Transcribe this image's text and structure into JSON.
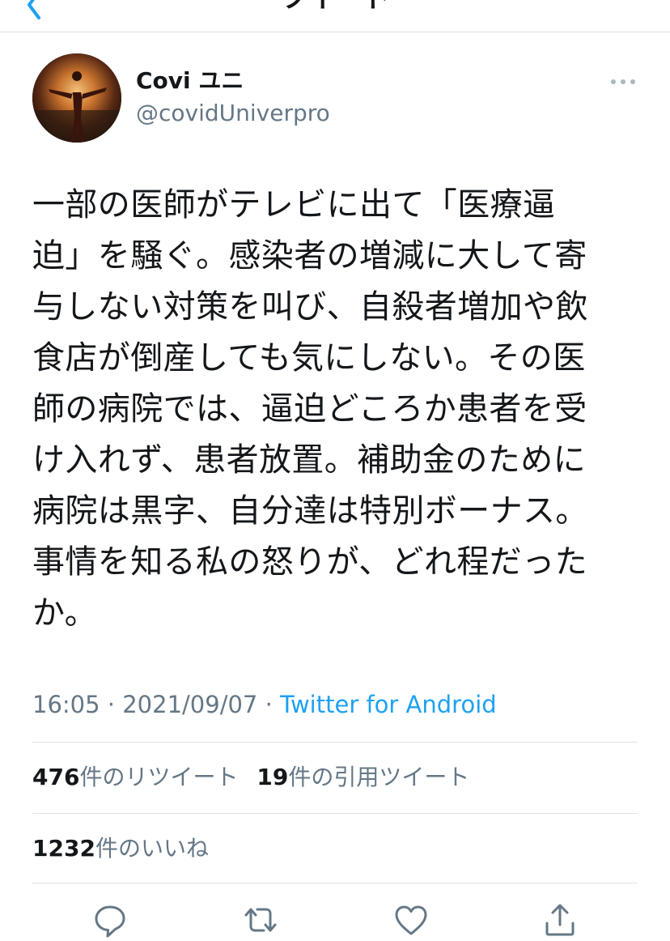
{
  "nav": {
    "title": "ツイート"
  },
  "tweet": {
    "author_name": "Covi ユニ",
    "author_handle": "@covidUniverpro",
    "text": "一部の医師がテレビに出て「医療逼\n迫」を騒ぐ。感染者の増減に大して寄\n与しない対策を叫び、自殺者増加や飲\n食店が倒産しても気にしない。その医\n師の病院では、逼迫どころか患者を受\nけ入れず、患者放置。補助金のために\n病院は黒字、自分達は特別ボーナス。\n事情を知る私の怒りが、どれ程だった\nか。",
    "time": "16:05",
    "separator": " · ",
    "date": "2021/09/07",
    "source": "Twitter for Android"
  },
  "stats": {
    "retweets_count": "476",
    "retweets_label": "件のリツイート",
    "quotes_count": "19",
    "quotes_label": "件の引用ツイート",
    "likes_count": "1232",
    "likes_label": "件のいいね"
  },
  "icons": {
    "back": "chevron-left-icon",
    "more": "more-dots-icon",
    "reply": "reply-icon",
    "retweet": "retweet-icon",
    "like": "heart-icon",
    "share": "share-icon"
  },
  "colors": {
    "accent": "#1da1f2",
    "text": "#14171a",
    "secondary": "#657786",
    "divider": "#dfe3e6"
  }
}
